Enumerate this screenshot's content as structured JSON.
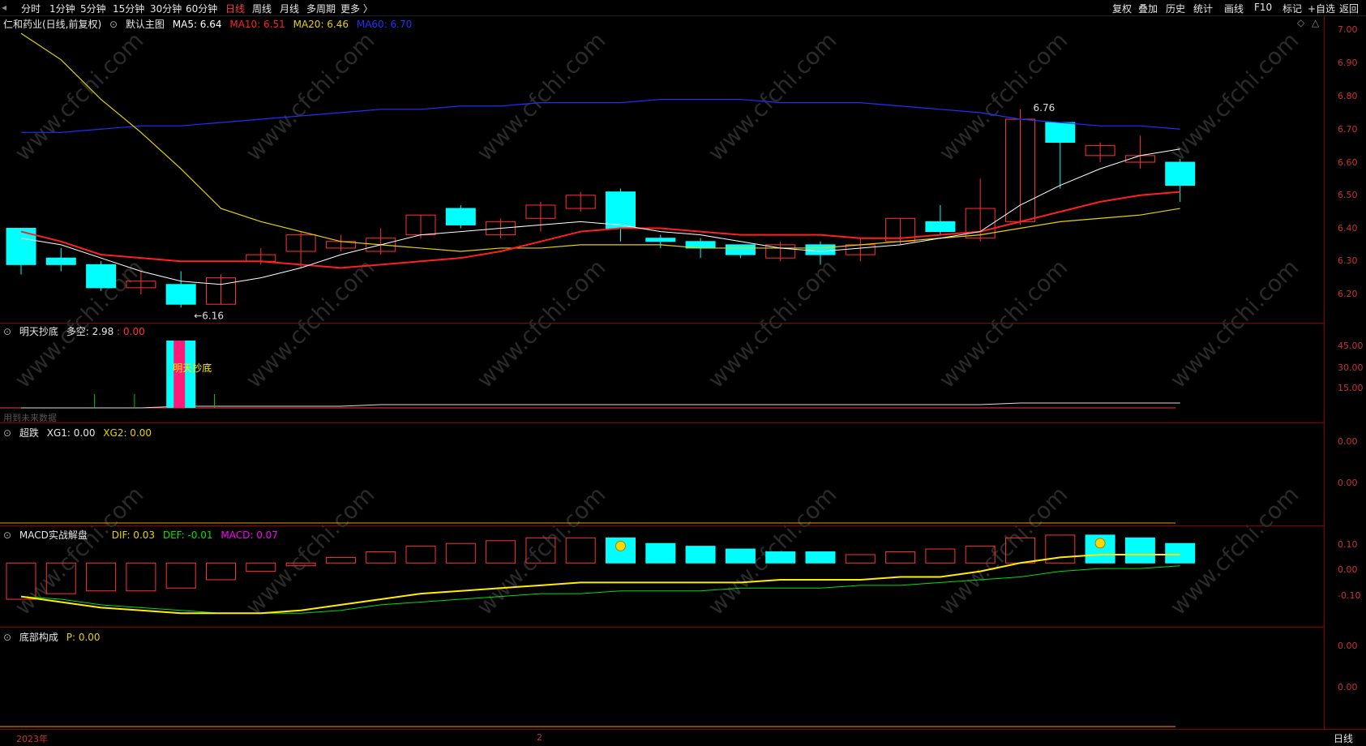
{
  "toolbar": {
    "left": [
      "分时",
      "1分钟",
      "5分钟",
      "15分钟",
      "30分钟",
      "60分钟",
      "日线",
      "周线",
      "月线",
      "多周期",
      "更多 〉"
    ],
    "active": "日线",
    "right": [
      "复权",
      "叠加",
      "历史",
      "统计",
      "画线",
      "F10",
      "标记",
      "+自选",
      "返回"
    ]
  },
  "main": {
    "title": "仁和药业(日线,前复权)",
    "template": "默认主图",
    "ma5": "MA5: 6.64",
    "ma10": "MA10: 6.51",
    "ma20": "MA20: 6.46",
    "ma60": "MA60: 6.70",
    "low_marker": "←6.16",
    "high_marker": "6.76",
    "y_ticks": [
      "7.00",
      "6.90",
      "6.80",
      "6.70",
      "6.60",
      "6.50",
      "6.40",
      "6.30",
      "6.20"
    ]
  },
  "panel2": {
    "name": "明天抄底",
    "field": "多空: 2.98",
    "field2": ": 0.00",
    "signal_label": "明天抄底",
    "warning": "用到未来数据",
    "y_ticks": [
      "45.00",
      "30.00",
      "15.00"
    ]
  },
  "panel3": {
    "name": "超跌",
    "xg1": "XG1: 0.00",
    "xg2": "XG2: 0.00",
    "y_ticks": [
      "0.00",
      "0.00"
    ]
  },
  "panel4": {
    "name": "MACD实战解盘",
    "dif": "DIF: 0.03",
    "def": "DEF: -0.01",
    "macd": "MACD: 0.07",
    "y_ticks": [
      "0.10",
      "0.00",
      "-0.10"
    ]
  },
  "panel5": {
    "name": "底部构成",
    "p": "P: 0.00",
    "y_ticks": [
      "0.00",
      "0.00"
    ]
  },
  "footer": {
    "year": "2023年",
    "month": "2",
    "period": "日线"
  },
  "colors": {
    "up": "#ff3232",
    "down": "#00ffff",
    "ma5": "#ffffff",
    "ma10": "#ff2020",
    "ma20": "#e6d200",
    "ma60": "#2030ff"
  },
  "chart_data": {
    "type": "candlestick",
    "y_range": [
      6.12,
      7.02
    ],
    "candles": [
      {
        "o": 6.4,
        "c": 6.29,
        "h": 6.4,
        "l": 6.26
      },
      {
        "o": 6.31,
        "c": 6.29,
        "h": 6.34,
        "l": 6.27
      },
      {
        "o": 6.29,
        "c": 6.22,
        "h": 6.3,
        "l": 6.21
      },
      {
        "o": 6.22,
        "c": 6.24,
        "h": 6.27,
        "l": 6.2
      },
      {
        "o": 6.23,
        "c": 6.17,
        "h": 6.27,
        "l": 6.16
      },
      {
        "o": 6.17,
        "c": 6.25,
        "h": 6.26,
        "l": 6.17
      },
      {
        "o": 6.3,
        "c": 6.32,
        "h": 6.34,
        "l": 6.29
      },
      {
        "o": 6.33,
        "c": 6.38,
        "h": 6.39,
        "l": 6.28
      },
      {
        "o": 6.34,
        "c": 6.36,
        "h": 6.38,
        "l": 6.33
      },
      {
        "o": 6.33,
        "c": 6.37,
        "h": 6.4,
        "l": 6.32
      },
      {
        "o": 6.38,
        "c": 6.44,
        "h": 6.44,
        "l": 6.37
      },
      {
        "o": 6.46,
        "c": 6.41,
        "h": 6.47,
        "l": 6.4
      },
      {
        "o": 6.38,
        "c": 6.42,
        "h": 6.43,
        "l": 6.37
      },
      {
        "o": 6.43,
        "c": 6.47,
        "h": 6.48,
        "l": 6.39
      },
      {
        "o": 6.46,
        "c": 6.5,
        "h": 6.51,
        "l": 6.45
      },
      {
        "o": 6.51,
        "c": 6.4,
        "h": 6.52,
        "l": 6.36
      },
      {
        "o": 6.37,
        "c": 6.36,
        "h": 6.38,
        "l": 6.34
      },
      {
        "o": 6.36,
        "c": 6.34,
        "h": 6.37,
        "l": 6.31
      },
      {
        "o": 6.35,
        "c": 6.32,
        "h": 6.35,
        "l": 6.31
      },
      {
        "o": 6.31,
        "c": 6.35,
        "h": 6.36,
        "l": 6.3
      },
      {
        "o": 6.35,
        "c": 6.32,
        "h": 6.36,
        "l": 6.29
      },
      {
        "o": 6.32,
        "c": 6.35,
        "h": 6.37,
        "l": 6.3
      },
      {
        "o": 6.36,
        "c": 6.43,
        "h": 6.43,
        "l": 6.35
      },
      {
        "o": 6.42,
        "c": 6.39,
        "h": 6.47,
        "l": 6.38
      },
      {
        "o": 6.37,
        "c": 6.46,
        "h": 6.55,
        "l": 6.36
      },
      {
        "o": 6.42,
        "c": 6.73,
        "h": 6.76,
        "l": 6.41
      },
      {
        "o": 6.72,
        "c": 6.66,
        "h": 6.72,
        "l": 6.52
      },
      {
        "o": 6.62,
        "c": 6.65,
        "h": 6.66,
        "l": 6.6
      },
      {
        "o": 6.6,
        "c": 6.62,
        "h": 6.68,
        "l": 6.58
      },
      {
        "o": 6.6,
        "c": 6.53,
        "h": 6.61,
        "l": 6.48
      }
    ],
    "ma5": [
      6.37,
      6.35,
      6.31,
      6.27,
      6.24,
      6.23,
      6.25,
      6.28,
      6.32,
      6.35,
      6.38,
      6.39,
      6.4,
      6.41,
      6.42,
      6.41,
      6.39,
      6.38,
      6.36,
      6.34,
      6.33,
      6.34,
      6.35,
      6.37,
      6.39,
      6.47,
      6.53,
      6.58,
      6.62,
      6.64
    ],
    "ma10": [
      6.39,
      6.36,
      6.32,
      6.31,
      6.3,
      6.3,
      6.3,
      6.29,
      6.28,
      6.29,
      6.3,
      6.31,
      6.33,
      6.36,
      6.39,
      6.4,
      6.4,
      6.39,
      6.38,
      6.38,
      6.38,
      6.37,
      6.37,
      6.38,
      6.39,
      6.42,
      6.45,
      6.48,
      6.5,
      6.51
    ],
    "ma20": [
      6.99,
      6.91,
      6.79,
      6.69,
      6.58,
      6.46,
      6.42,
      6.39,
      6.36,
      6.35,
      6.34,
      6.33,
      6.34,
      6.34,
      6.35,
      6.35,
      6.35,
      6.34,
      6.34,
      6.34,
      6.34,
      6.35,
      6.36,
      6.37,
      6.38,
      6.4,
      6.42,
      6.43,
      6.44,
      6.46
    ],
    "ma60": [
      6.69,
      6.69,
      6.7,
      6.71,
      6.71,
      6.72,
      6.73,
      6.74,
      6.75,
      6.76,
      6.76,
      6.77,
      6.77,
      6.78,
      6.78,
      6.78,
      6.79,
      6.79,
      6.79,
      6.78,
      6.78,
      6.78,
      6.77,
      6.76,
      6.75,
      6.73,
      6.72,
      6.71,
      6.71,
      6.7
    ],
    "macd_bars": [
      -0.13,
      -0.11,
      -0.1,
      -0.1,
      -0.09,
      -0.06,
      -0.03,
      -0.01,
      0.02,
      0.04,
      0.06,
      0.07,
      0.08,
      0.09,
      0.09,
      0.09,
      0.07,
      0.06,
      0.05,
      0.04,
      0.04,
      0.03,
      0.04,
      0.05,
      0.06,
      0.09,
      0.1,
      0.1,
      0.09,
      0.07
    ],
    "dif": [
      -0.12,
      -0.14,
      -0.16,
      -0.17,
      -0.18,
      -0.18,
      -0.18,
      -0.17,
      -0.15,
      -0.13,
      -0.11,
      -0.1,
      -0.09,
      -0.08,
      -0.07,
      -0.07,
      -0.07,
      -0.07,
      -0.07,
      -0.06,
      -0.06,
      -0.06,
      -0.05,
      -0.05,
      -0.03,
      0.0,
      0.02,
      0.03,
      0.03,
      0.03
    ],
    "def": [
      -0.12,
      -0.13,
      -0.15,
      -0.16,
      -0.17,
      -0.18,
      -0.18,
      -0.18,
      -0.17,
      -0.15,
      -0.14,
      -0.13,
      -0.12,
      -0.11,
      -0.11,
      -0.1,
      -0.1,
      -0.1,
      -0.09,
      -0.09,
      -0.09,
      -0.08,
      -0.08,
      -0.07,
      -0.06,
      -0.05,
      -0.03,
      -0.02,
      -0.02,
      -0.01
    ],
    "macd_range": [
      -0.22,
      0.12
    ],
    "kongduo": [
      0,
      0,
      0,
      0,
      1,
      1,
      1,
      1,
      1,
      2,
      2,
      2,
      2,
      2,
      2,
      2,
      2,
      2,
      2,
      2,
      2,
      2,
      2,
      2,
      2,
      3,
      3,
      3,
      3,
      3
    ],
    "signal_index": 4,
    "smile_indices": [
      15,
      27
    ]
  }
}
